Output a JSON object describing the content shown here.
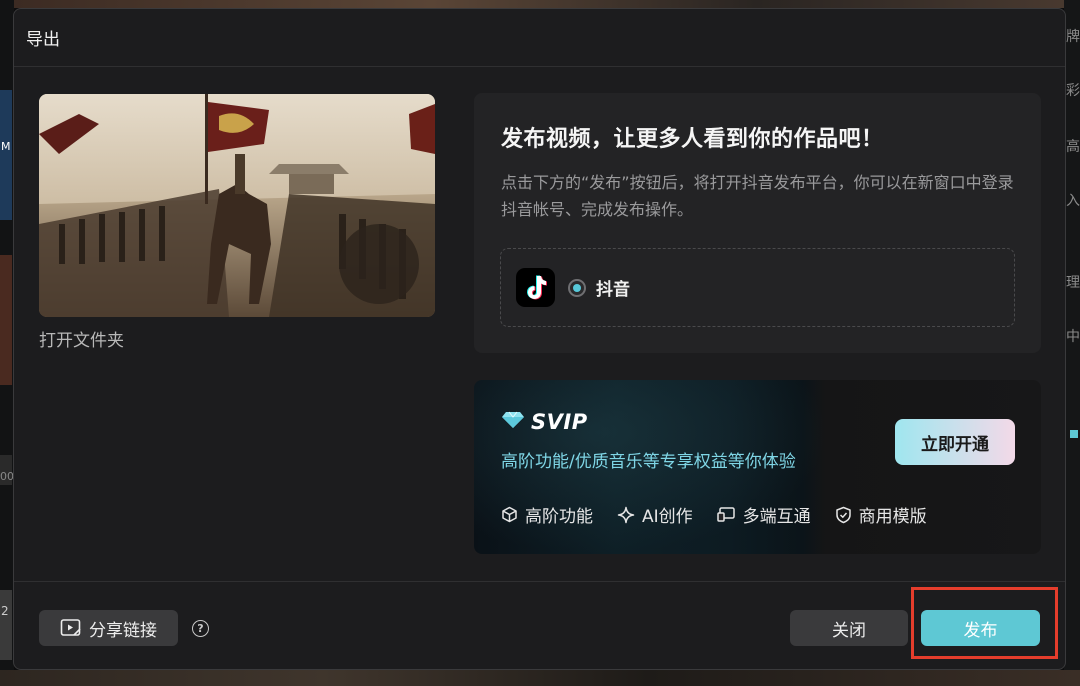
{
  "dialog": {
    "title": "导出"
  },
  "preview": {
    "open_folder_label": "打开文件夹"
  },
  "platform_card": {
    "title": "发布视频，让更多人看到你的作品吧！",
    "description": "点击下方的“发布”按钮后，将打开抖音发布平台，你可以在新窗口中登录抖音帐号、完成发布操作。",
    "platform_option": {
      "label": "抖音",
      "selected": true,
      "icon": "douyin-logo-icon"
    }
  },
  "svip_card": {
    "title": "SVIP",
    "subtitle": "高阶功能/优质音乐等专享权益等你体验",
    "cta_label": "立即开通",
    "features": [
      {
        "label": "高阶功能",
        "icon": "cube-icon"
      },
      {
        "label": "AI创作",
        "icon": "sparkle-icon"
      },
      {
        "label": "多端互通",
        "icon": "devices-icon"
      },
      {
        "label": "商用模版",
        "icon": "shield-check-icon"
      }
    ]
  },
  "footer": {
    "share_label": "分享链接",
    "help_symbol": "?",
    "close_label": "关闭",
    "publish_label": "发布"
  },
  "background": {
    "right_edge_chars": [
      "牌",
      "彩",
      "高",
      "入",
      "理",
      "中"
    ],
    "left_edge_chars": [
      "M",
      "00",
      "2"
    ]
  },
  "colors": {
    "accent": "#5ec8d4",
    "highlight": "#e53d2c",
    "svip_subtitle": "#7fd6e6"
  }
}
